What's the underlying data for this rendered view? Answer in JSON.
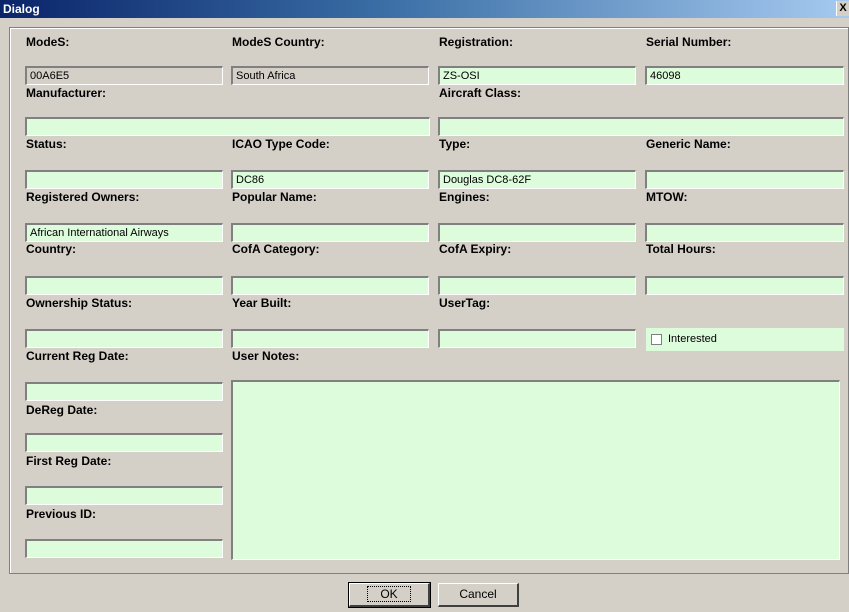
{
  "window": {
    "title": "Dialog",
    "close_glyph": "X"
  },
  "labels": {
    "modes": "ModeS:",
    "modes_country": "ModeS Country:",
    "registration": "Registration:",
    "serial": "Serial Number:",
    "manufacturer": "Manufacturer:",
    "aircraft_class": "Aircraft Class:",
    "status": "Status:",
    "icao": "ICAO Type Code:",
    "type": "Type:",
    "generic": "Generic Name:",
    "owners": "Registered Owners:",
    "popular": "Popular Name:",
    "engines": "Engines:",
    "mtow": "MTOW:",
    "country": "Country:",
    "cofa_cat": "CofA Category:",
    "cofa_exp": "CofA Expiry:",
    "hours": "Total Hours:",
    "ownership": "Ownership Status:",
    "year": "Year Built:",
    "usertag": "UserTag:",
    "cur_reg": "Current Reg Date:",
    "notes": "User Notes:",
    "dereg": "DeReg Date:",
    "first_reg": "First Reg Date:",
    "prev_id": "Previous ID:"
  },
  "values": {
    "modes": "00A6E5",
    "modes_country": "South Africa",
    "registration": "ZS-OSI",
    "serial": "46098",
    "manufacturer": "",
    "aircraft_class": "",
    "status": "",
    "icao": "DC86",
    "type": "Douglas DC8-62F",
    "generic": "",
    "owners": "African International Airways",
    "popular": "",
    "engines": "",
    "mtow": "",
    "country": "",
    "cofa_cat": "",
    "cofa_exp": "",
    "hours": "",
    "ownership": "",
    "year": "",
    "usertag": "",
    "cur_reg": "",
    "notes": "",
    "dereg": "",
    "first_reg": "",
    "prev_id": ""
  },
  "checkbox": {
    "label": "Interested",
    "checked": false
  },
  "buttons": {
    "ok": "OK",
    "cancel": "Cancel"
  },
  "colors": {
    "field_bg": "#ddfcdc",
    "dialog_bg": "#d4d0c8",
    "title_start": "#0a246a",
    "title_end": "#a6caf0"
  }
}
